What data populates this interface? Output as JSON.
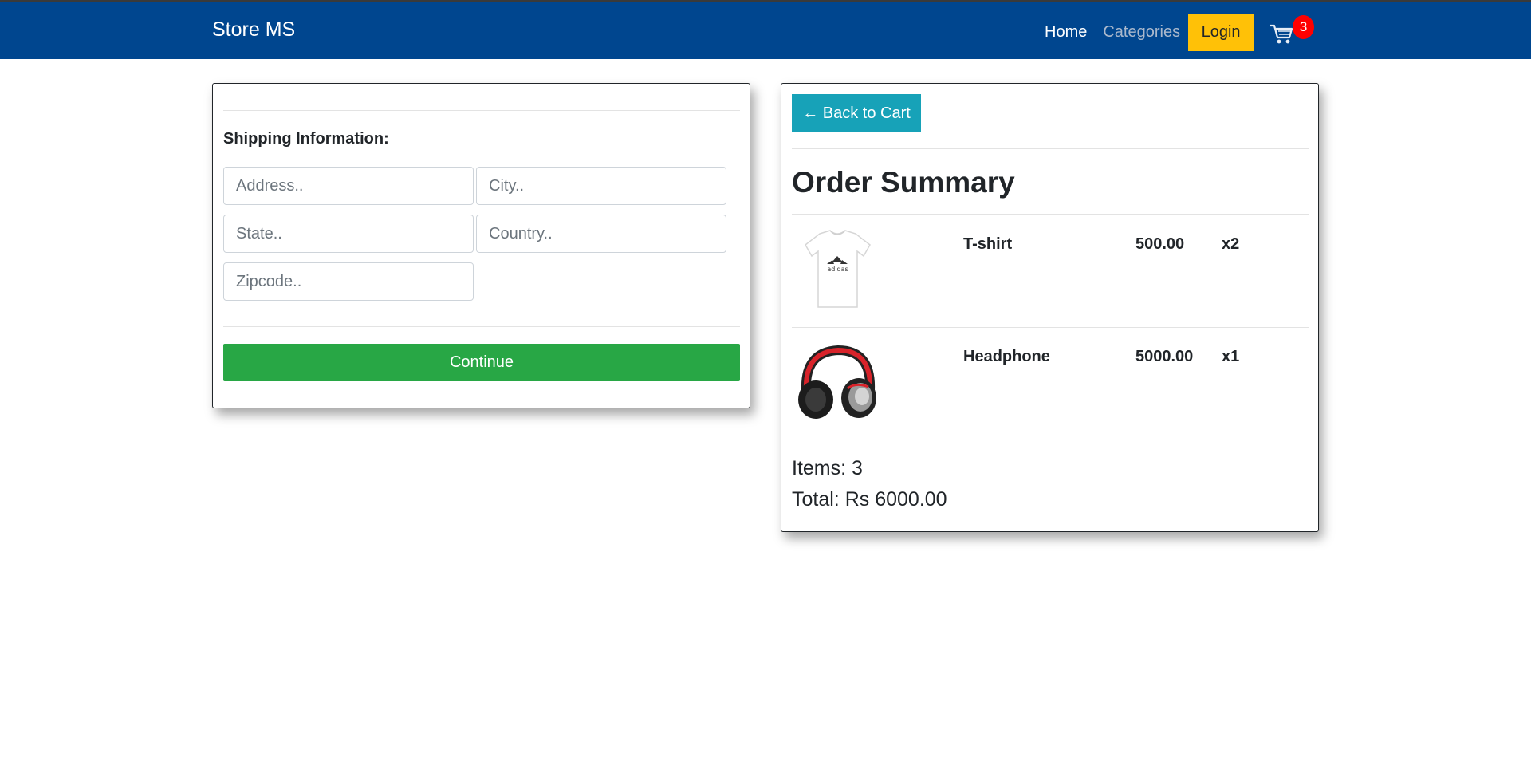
{
  "navbar": {
    "brand": "Store MS",
    "links": [
      "Home",
      "Categories"
    ],
    "login_label": "Login",
    "cart_count": "3"
  },
  "shipping": {
    "title": "Shipping Information:",
    "placeholders": {
      "address": "Address..",
      "city": "City..",
      "state": "State..",
      "country": "Country..",
      "zipcode": "Zipcode.."
    },
    "continue_label": "Continue"
  },
  "summary": {
    "back_label": "← Back to Cart",
    "title": "Order Summary",
    "items": [
      {
        "name": "T-shirt",
        "price": "500.00",
        "qty": "x2",
        "icon": "tshirt-image"
      },
      {
        "name": "Headphone",
        "price": "5000.00",
        "qty": "x1",
        "icon": "headphone-image"
      }
    ],
    "items_count": "Items: 3",
    "total": "Total: Rs 6000.00"
  },
  "colors": {
    "navbar": "#00468f",
    "login": "#ffc107",
    "continue": "#28a745",
    "back": "#17a2b8",
    "badge": "#ff0000"
  }
}
